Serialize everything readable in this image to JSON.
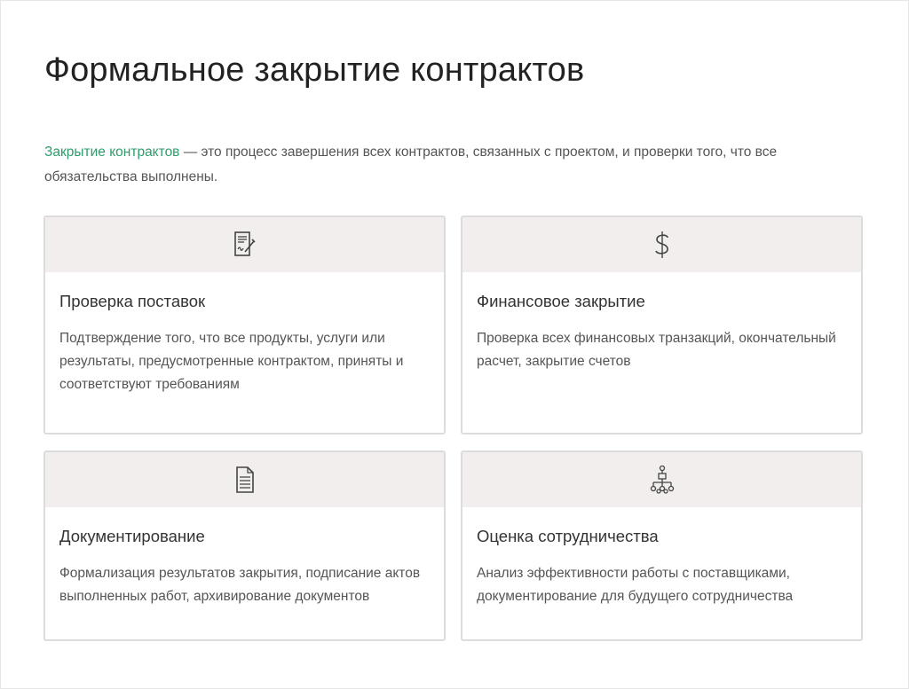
{
  "title": "Формальное закрытие контрактов",
  "intro": {
    "term": "Закрытие контрактов",
    "text": " — это процесс завершения всех контрактов, связанных с проектом, и проверки того, что все обязательства выполнены."
  },
  "accent_color": "#2e9c6a",
  "cards": [
    {
      "icon": "signed-document-icon",
      "title": "Проверка поставок",
      "text": "Подтверждение того, что все продукты, услуги или результаты, предусмотренные контрактом, приняты и соответствуют требованиям"
    },
    {
      "icon": "dollar-icon",
      "title": "Финансовое закрытие",
      "text": "Проверка всех финансовых транзакций, окончательный расчет, закрытие счетов"
    },
    {
      "icon": "document-icon",
      "title": "Документирование",
      "text": "Формализация результатов закрытия, подписание актов выполненных работ, архивирование документов"
    },
    {
      "icon": "org-chart-icon",
      "title": "Оценка сотрудничества",
      "text": "Анализ эффективности работы с поставщиками, документирование для будущего сотрудничества"
    }
  ]
}
